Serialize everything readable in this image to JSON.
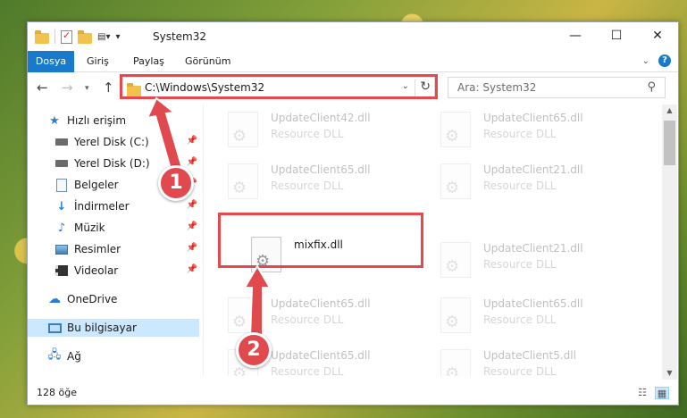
{
  "window": {
    "title": "System32",
    "controls": {
      "minimize": "—",
      "maximize": "☐",
      "close": "✕"
    }
  },
  "ribbon": {
    "tabs": [
      "Dosya",
      "Giriş",
      "Paylaş",
      "Görünüm"
    ],
    "help": "?"
  },
  "address": {
    "path": "C:\\Windows\\System32",
    "search_placeholder": "Ara: System32"
  },
  "sidebar": {
    "quick_access": "Hızlı erişim",
    "items": [
      {
        "label": "Yerel Disk (C:)",
        "icon": "drive-icon",
        "pinned": true
      },
      {
        "label": "Yerel Disk (D:)",
        "icon": "drive-icon",
        "pinned": true
      },
      {
        "label": "Belgeler",
        "icon": "documents-icon",
        "pinned": true
      },
      {
        "label": "İndirmeler",
        "icon": "downloads-icon",
        "pinned": true
      },
      {
        "label": "Müzik",
        "icon": "music-icon",
        "pinned": true
      },
      {
        "label": "Resimler",
        "icon": "pictures-icon",
        "pinned": true
      },
      {
        "label": "Videolar",
        "icon": "videos-icon",
        "pinned": true
      }
    ],
    "onedrive": "OneDrive",
    "this_pc": "Bu bilgisayar",
    "network": "Ağ"
  },
  "files": [
    {
      "name": "UpdateClient42.dll",
      "type": "Resource DLL",
      "faded": true
    },
    {
      "name": "UpdateClient65.dll",
      "type": "Resource DLL",
      "faded": true
    },
    {
      "name": "UpdateClient65.dll",
      "type": "Resource DLL",
      "faded": true
    },
    {
      "name": "UpdateClient21.dll",
      "type": "Resource DLL",
      "faded": true
    },
    {
      "name": "mixfix.dll",
      "type": "",
      "faded": false
    },
    {
      "name": "UpdateClient21.dll",
      "type": "Resource DLL",
      "faded": true
    },
    {
      "name": "UpdateClient65.dll",
      "type": "Resource DLL",
      "faded": true
    },
    {
      "name": "UpdateClient65.dll",
      "type": "Resource DLL",
      "faded": true
    },
    {
      "name": "UpdateClient65.dll",
      "type": "Resource DLL",
      "faded": true
    },
    {
      "name": "UpdateClient5.dll",
      "type": "Resource DLL",
      "faded": true
    }
  ],
  "status": {
    "item_count": "128 öğe"
  },
  "annotations": {
    "badge_1": "1",
    "badge_2": "2",
    "highlight_color": "#e5484d"
  },
  "colors": {
    "accent": "#1979ca",
    "selection": "#cce8ff"
  }
}
